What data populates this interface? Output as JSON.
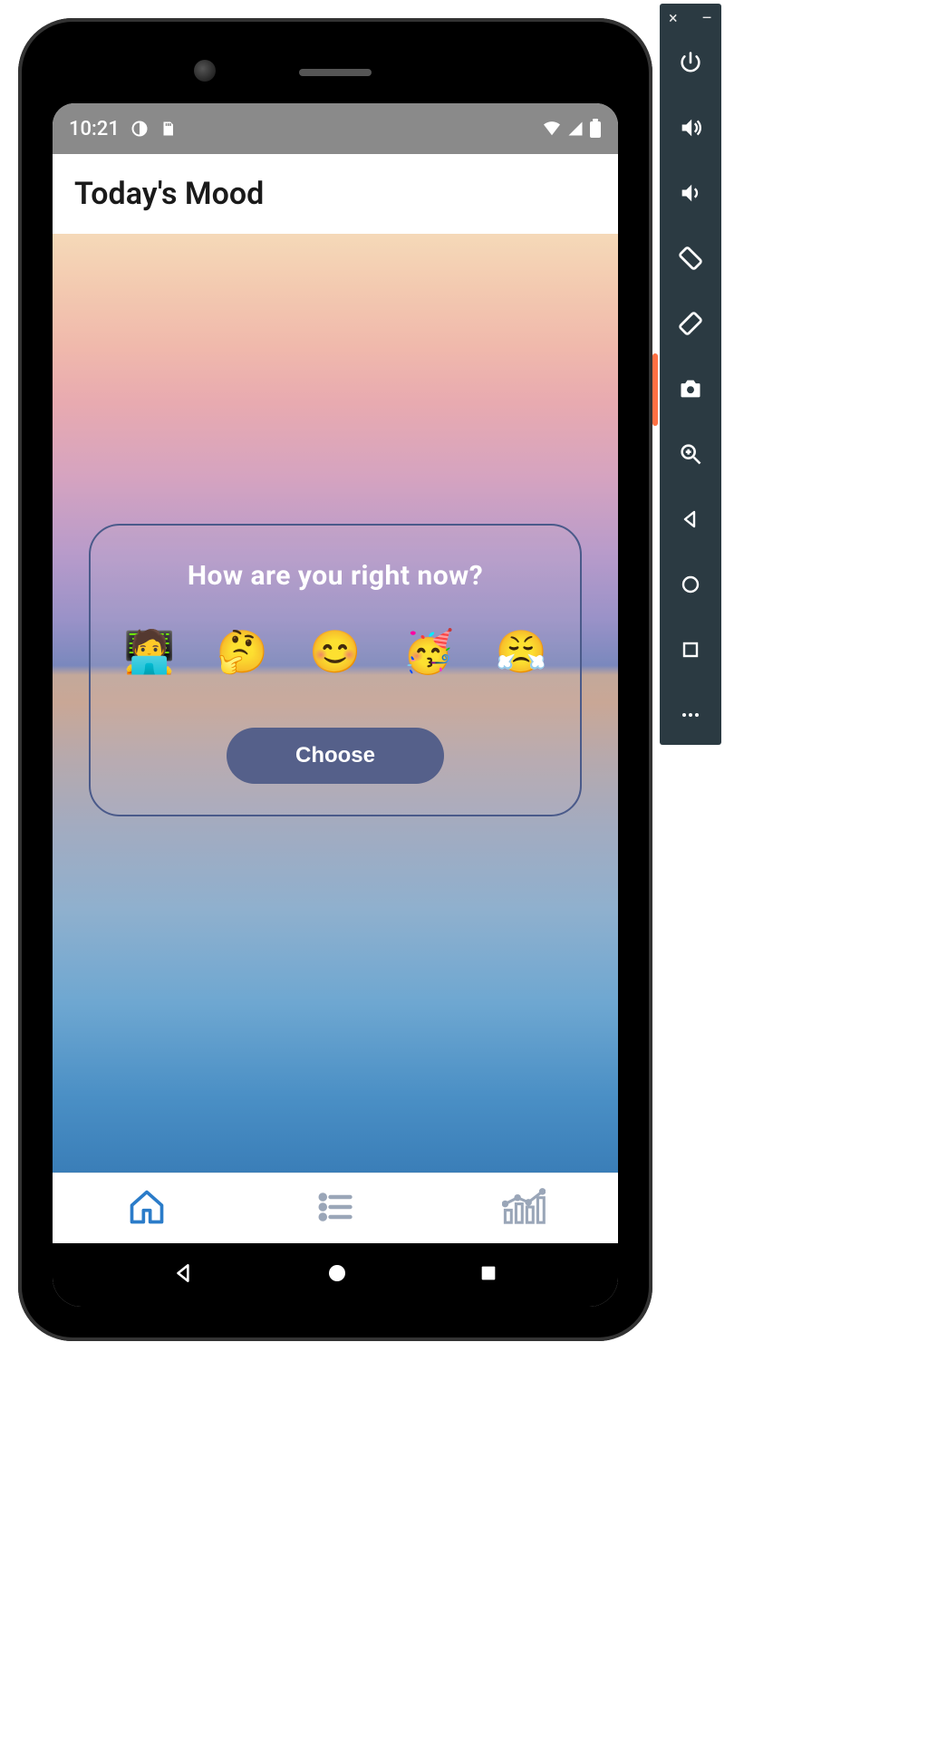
{
  "status_bar": {
    "time": "10:21"
  },
  "app": {
    "header_title": "Today's Mood",
    "card": {
      "prompt": "How are you right now?",
      "emoji_options": [
        "🧑‍💻",
        "🤔",
        "😊",
        "🥳",
        "😤"
      ],
      "choose_button_label": "Choose"
    },
    "bottom_nav": {
      "items": [
        "home",
        "list",
        "stats"
      ]
    }
  },
  "emulator_toolbar": {
    "close": "×",
    "minimize": "–",
    "tools": [
      "power",
      "volume-up",
      "volume-down",
      "rotate-left",
      "rotate-right",
      "camera",
      "zoom",
      "back",
      "home",
      "overview",
      "more"
    ]
  },
  "colors": {
    "accent": "#2b7cc9",
    "card_border": "#4a5a8a",
    "button_bg": "#55608a",
    "toolbar_bg": "#2b3a42"
  }
}
